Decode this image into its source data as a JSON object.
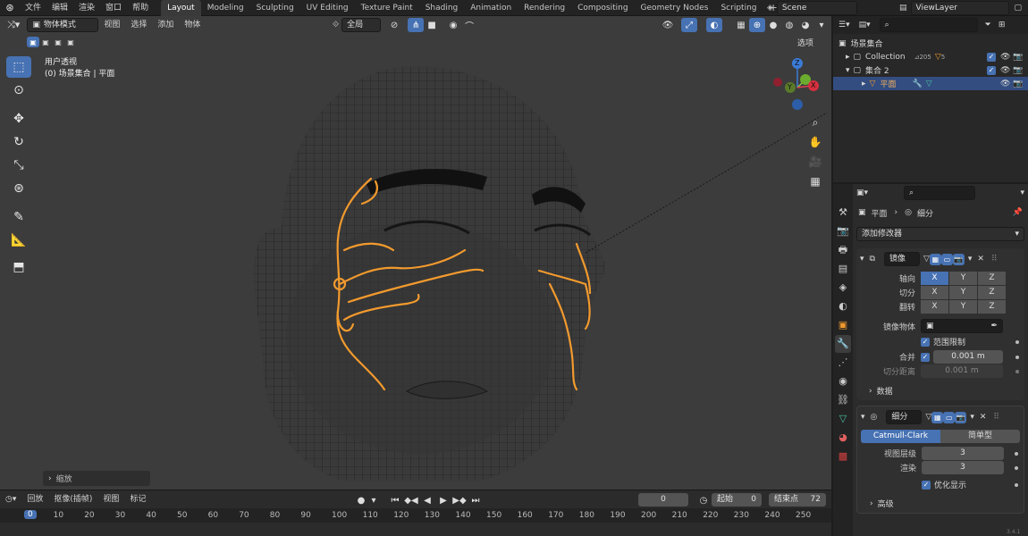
{
  "menu": [
    "文件",
    "编辑",
    "渲染",
    "窗口",
    "帮助"
  ],
  "workspaces": [
    "Layout",
    "Modeling",
    "Sculpting",
    "UV Editing",
    "Texture Paint",
    "Shading",
    "Animation",
    "Rendering",
    "Compositing",
    "Geometry Nodes",
    "Scripting"
  ],
  "active_workspace": "Layout",
  "scene_name": "Scene",
  "view_layer": "ViewLayer",
  "viewport": {
    "mode": "物体模式",
    "menus": [
      "视图",
      "选择",
      "添加",
      "物体"
    ],
    "transform_orientation": "全局",
    "options_label": "选项",
    "view_name": "用户透视",
    "view_info": "(0) 场景集合 | 平面",
    "last_op": "缩放",
    "gizmo": {
      "z": "Z",
      "y": "Y",
      "x": "X"
    }
  },
  "timeline": {
    "menus": [
      "回放",
      "抠像(插帧)",
      "视图",
      "标记"
    ],
    "current_frame": "0",
    "start_label": "起始",
    "start": "0",
    "end_label": "结束点",
    "end": "72",
    "ruler": [
      "0",
      "10",
      "20",
      "30",
      "40",
      "50",
      "60",
      "70",
      "80",
      "90",
      "100",
      "110",
      "120",
      "130",
      "140",
      "150",
      "160",
      "170",
      "180",
      "190",
      "200",
      "210",
      "220",
      "230",
      "240",
      "250"
    ]
  },
  "outliner": {
    "root": "场景集合",
    "items": [
      {
        "name": "Collection",
        "extra1": "205",
        "extra2": "5"
      },
      {
        "name": "集合 2"
      },
      {
        "name": "平面"
      }
    ]
  },
  "properties": {
    "object_name": "平面",
    "modifier_name": "细分",
    "add_modifier": "添加修改器",
    "mirror": {
      "name": "镜像",
      "axis_label": "轴向",
      "bisect_label": "切分",
      "flip_label": "翻转",
      "axes": [
        "X",
        "Y",
        "Z"
      ],
      "mirror_object_label": "镜像物体",
      "clipping_label": "范围限制",
      "merge_label": "合并",
      "merge_value": "0.001 m",
      "bisect_distance_label": "切分距离",
      "bisect_distance_value": "0.001 m",
      "data_label": "数据"
    },
    "subsurf": {
      "name": "细分",
      "type_catmull": "Catmull-Clark",
      "type_simple": "简单型",
      "levels_viewport_label": "视图层级",
      "levels_viewport": "3",
      "render_label": "渲染",
      "render": "3",
      "optimal_label": "优化显示",
      "advanced_label": "高级"
    }
  },
  "version": "3.4.1",
  "colors": {
    "accent": "#4772b3",
    "selection": "#f29a2e",
    "viewport_bg": "#3c3c3c"
  }
}
